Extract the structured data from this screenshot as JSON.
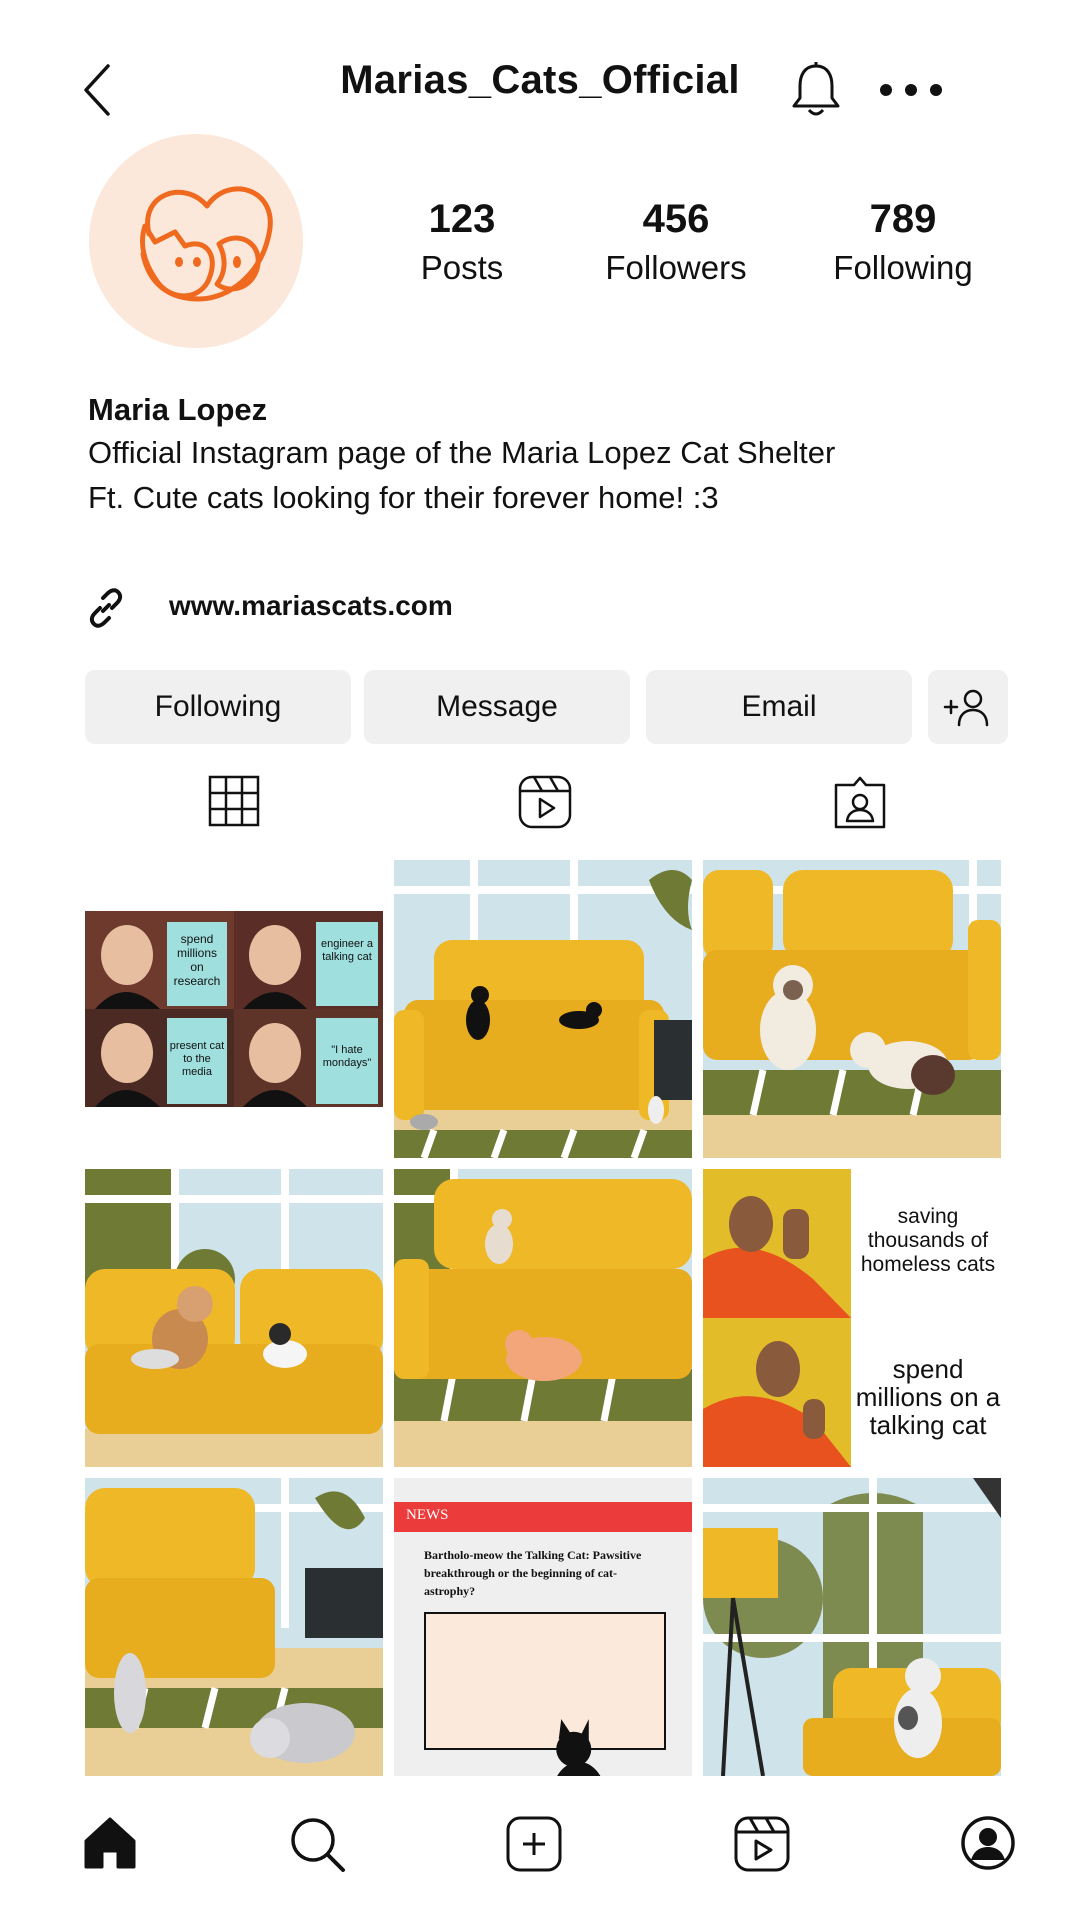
{
  "header": {
    "username": "Marias_Cats_Official",
    "icons": [
      "back-icon",
      "bell-icon",
      "more-icon"
    ]
  },
  "profile": {
    "stats": [
      {
        "value": "123",
        "label": "Posts"
      },
      {
        "value": "456",
        "label": "Followers"
      },
      {
        "value": "789",
        "label": "Following"
      }
    ],
    "name": "Maria Lopez",
    "bio_line1": "Official Instagram page of the Maria Lopez Cat Shelter",
    "bio_line2": "Ft. Cute cats looking for their forever home! :3",
    "website": "www.mariascats.com"
  },
  "actions": {
    "following": "Following",
    "message": "Message",
    "email": "Email"
  },
  "tabs": [
    "grid-icon",
    "reels-icon",
    "tagged-icon"
  ],
  "posts": {
    "meme1": {
      "texts": [
        "spend millions on research",
        "engineer a talking cat",
        "present cat to the media",
        "\"I hate mondays\""
      ]
    },
    "meme2": {
      "top": "saving thousands of homeless cats",
      "bottom": "spend millions on a talking cat"
    },
    "news": {
      "tag": "NEWS",
      "headline": "Bartholo-meow the Talking Cat: Pawsitive breakthrough or the beginning of cat-astrophy?"
    }
  },
  "colors": {
    "sofa": "#efb827",
    "floor": "#e9cf96",
    "stripe": "#6f7a35",
    "window": "#cfe3ea",
    "news_red": "#ec3b3b",
    "brand_orange": "#ef6a1e"
  },
  "nav": [
    "home-icon",
    "search-icon",
    "create-icon",
    "reels-icon",
    "profile-icon"
  ]
}
